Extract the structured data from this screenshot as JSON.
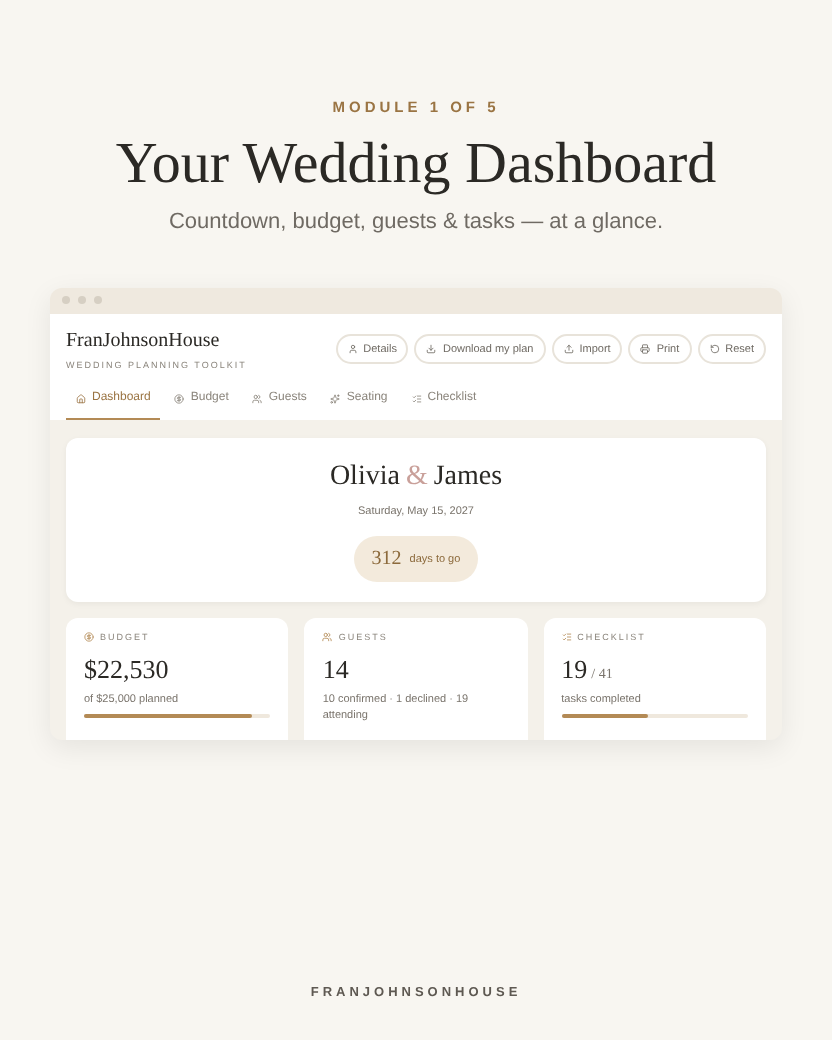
{
  "eyebrow": "MODULE 1 OF 5",
  "title": "Your Wedding Dashboard",
  "subtitle": "Countdown, budget, guests & tasks — at a glance.",
  "app": {
    "brand": "FranJohnsonHouse",
    "tagline": "WEDDING PLANNING TOOLKIT",
    "actions": [
      {
        "kind": "details",
        "label": "Details"
      },
      {
        "kind": "download",
        "label": "Download my plan"
      },
      {
        "kind": "import",
        "label": "Import"
      },
      {
        "kind": "print",
        "label": "Print"
      },
      {
        "kind": "reset",
        "label": "Reset"
      }
    ],
    "tabs": [
      {
        "kind": "home",
        "label": "Dashboard",
        "selected": true
      },
      {
        "kind": "budget",
        "label": "Budget",
        "selected": false
      },
      {
        "kind": "guests",
        "label": "Guests",
        "selected": false
      },
      {
        "kind": "seating",
        "label": "Seating",
        "selected": false
      },
      {
        "kind": "checklist",
        "label": "Checklist",
        "selected": false
      }
    ],
    "hero": {
      "name1": "Olivia",
      "ampersand": "&",
      "name2": "James",
      "date": "Saturday, May 15, 2027",
      "days": "312",
      "days_label": "days to go"
    },
    "stats": [
      {
        "kind": "budget",
        "label": "BUDGET",
        "value": "$22,530",
        "note": "of $25,000 planned",
        "level": 0.9
      },
      {
        "kind": "guests",
        "label": "GUESTS",
        "value": "14",
        "note": "10 confirmed · 1 declined · 19 attending"
      },
      {
        "kind": "checklist",
        "label": "CHECKLIST",
        "value": "19",
        "of": "/ 41",
        "note": "tasks completed",
        "level": 0.46
      }
    ]
  },
  "footer": "FRANJOHNSONHOUSE"
}
